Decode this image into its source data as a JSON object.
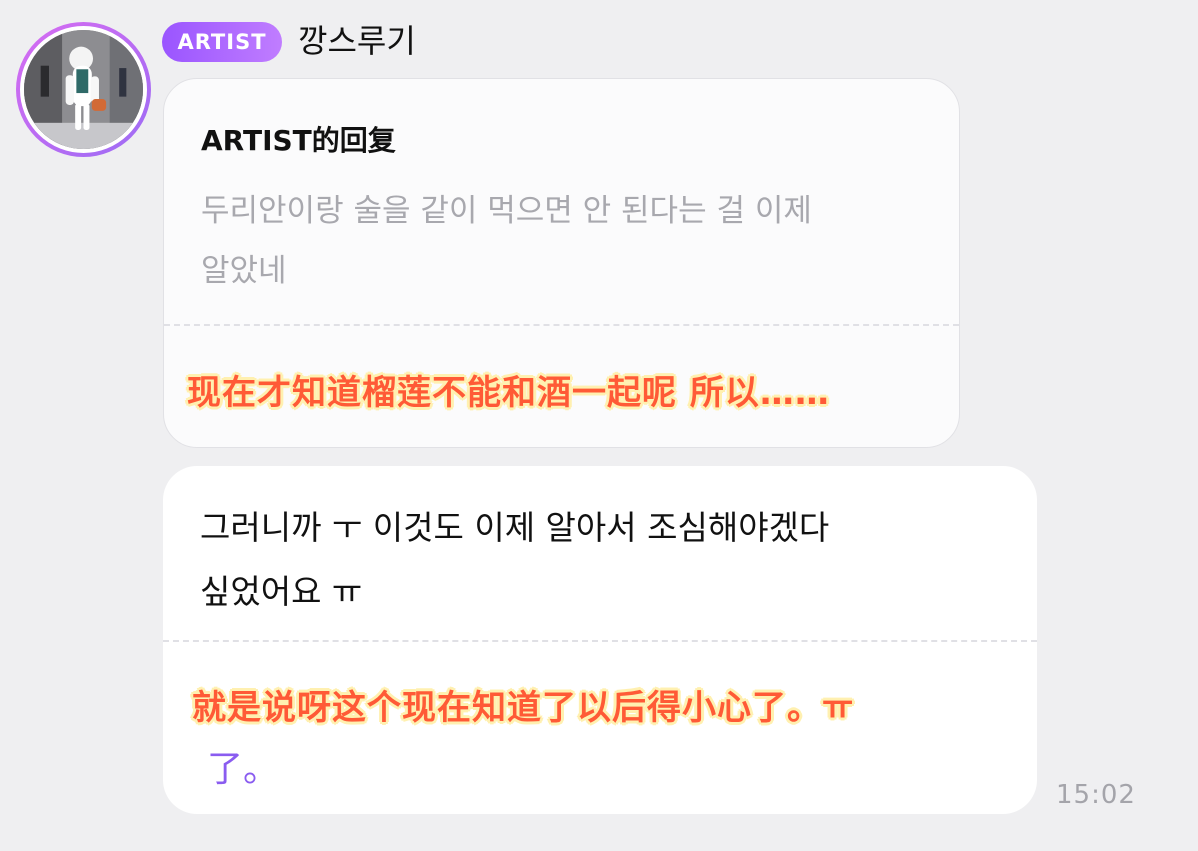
{
  "header": {
    "badge": "ARTIST",
    "username": "깡스루기"
  },
  "reply_card": {
    "title": "ARTIST的回复",
    "quote": "두리안이랑 술을 같이 먹으면 안 된다는 걸 이제\n알았네",
    "translation": "现在才知道榴莲不能和酒一起呢 所以……"
  },
  "message": {
    "text": "그러니까 ㅜ 이것도 이제 알아서 조심해야겠다\n싶었어요 ㅠ",
    "translation": "就是说呀这个现在知道了以后得小心了。ㅠ",
    "translation_tail": "了。",
    "time": "15:02"
  },
  "colors": {
    "background": "#efeff1",
    "accent": "#9a55ff",
    "translation": "#ff5a36"
  },
  "icons": {
    "avatar": "polar-bear-avatar"
  }
}
